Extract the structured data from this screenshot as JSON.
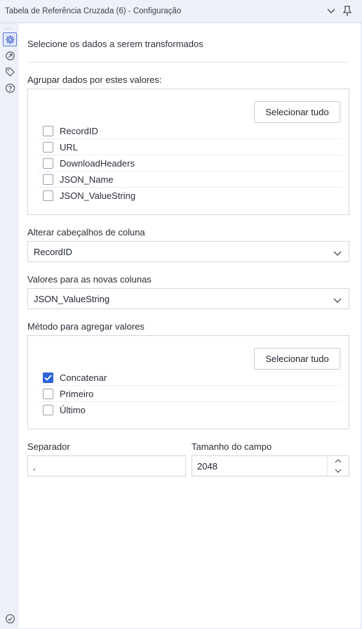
{
  "window": {
    "title": "Tabela de Referência Cruzada (6) - Configuração"
  },
  "rail": {
    "dots": "...",
    "icons": [
      "gear-icon",
      "output-icon",
      "tag-icon",
      "help-icon"
    ]
  },
  "main": {
    "heading": "Selecione os dados a serem transformados",
    "group_section": {
      "label": "Agrupar dados por estes valores:",
      "select_all_label": "Selecionar tudo",
      "items": [
        {
          "label": "RecordID",
          "checked": false
        },
        {
          "label": "URL",
          "checked": false
        },
        {
          "label": "DownloadHeaders",
          "checked": false
        },
        {
          "label": "JSON_Name",
          "checked": false
        },
        {
          "label": "JSON_ValueString",
          "checked": false
        }
      ]
    },
    "headers_section": {
      "label": "Alterar cabeçalhos de coluna",
      "selected": "RecordID"
    },
    "values_section": {
      "label": "Valores para as novas colunas",
      "selected": "JSON_ValueString"
    },
    "method_section": {
      "label": "Método para agregar valores",
      "select_all_label": "Selecionar tudo",
      "items": [
        {
          "label": "Concatenar",
          "checked": true
        },
        {
          "label": "Primeiro",
          "checked": false
        },
        {
          "label": "Último",
          "checked": false
        }
      ]
    },
    "separator": {
      "label": "Separador",
      "value": ","
    },
    "field_size": {
      "label": "Tamanho do campo",
      "value": "2048"
    }
  },
  "colors": {
    "accent": "#2f63d6",
    "panel_bg": "#ffffff",
    "chrome_bg": "#eef1f8"
  }
}
